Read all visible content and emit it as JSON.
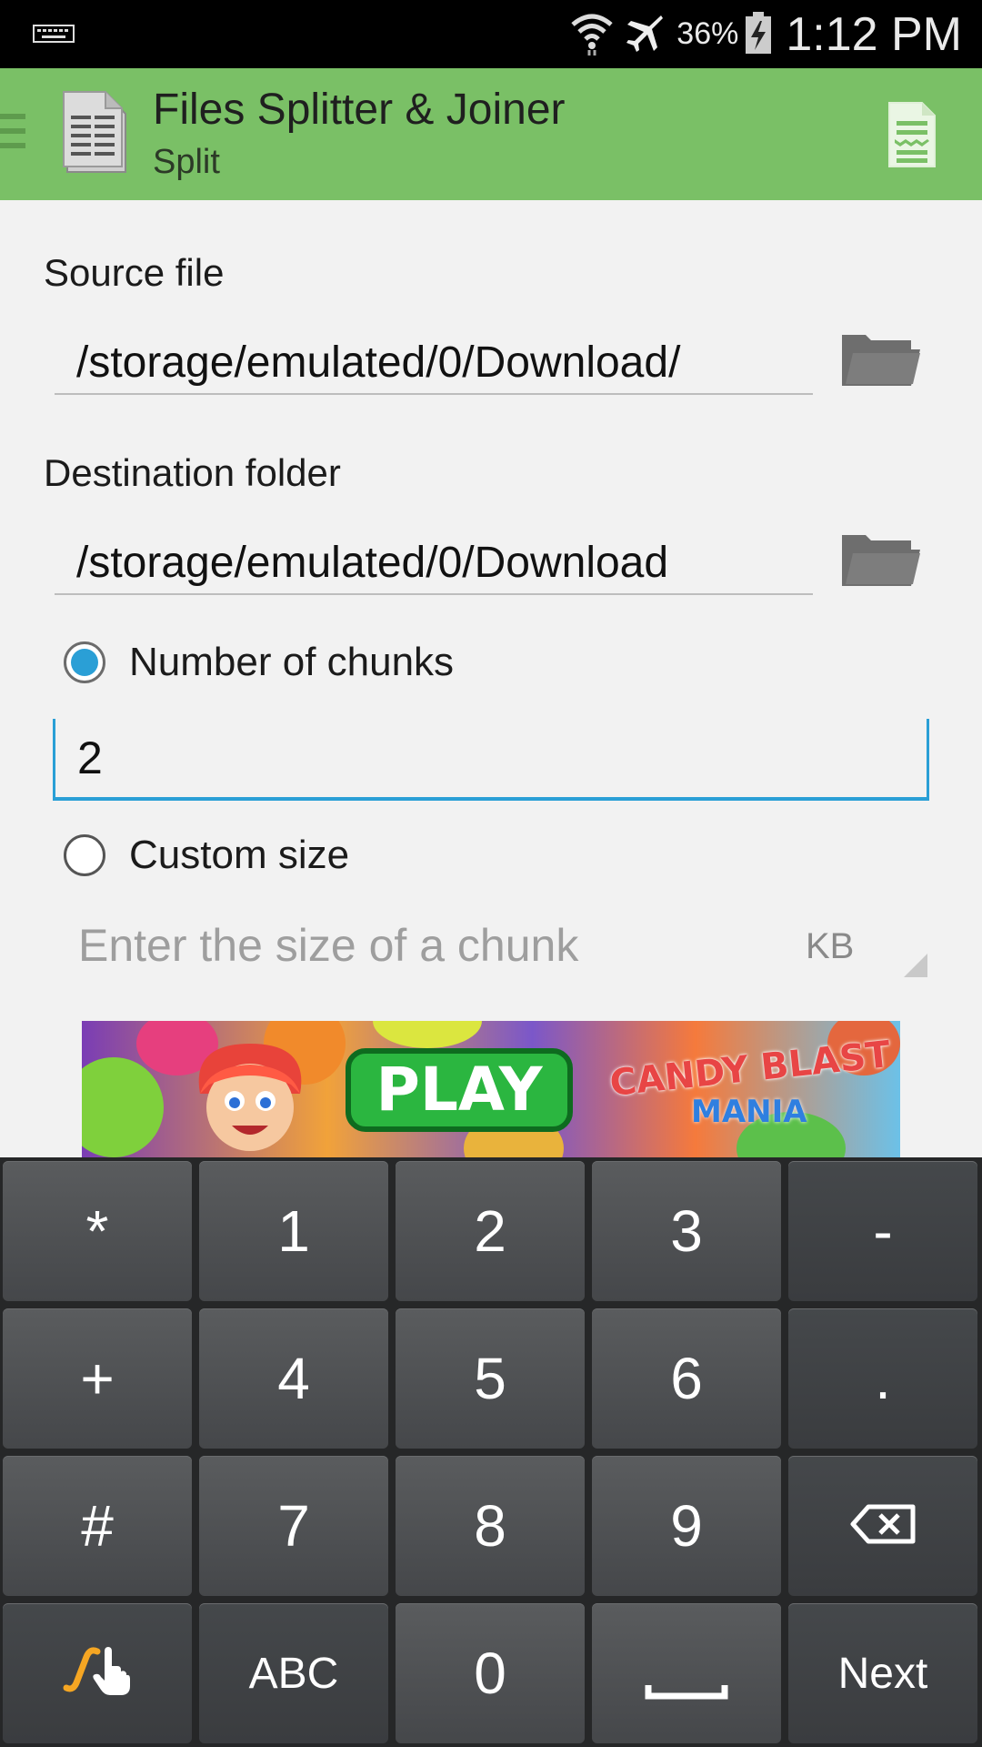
{
  "status_bar": {
    "battery": "36%",
    "time": "1:12 PM",
    "icons": [
      "keyboard-icon",
      "wifi-icon",
      "airplane-mode-icon",
      "battery-charging-icon"
    ]
  },
  "action_bar": {
    "title": "Files Splitter & Joiner",
    "subtitle": "Split",
    "bg_color": "#7ac066"
  },
  "form": {
    "source_label": "Source file",
    "source_value": "/storage/emulated/0/Download/",
    "destination_label": "Destination folder",
    "destination_value": "/storage/emulated/0/Download",
    "option_chunks_label": "Number of chunks",
    "option_chunks_selected": true,
    "chunks_value": "2",
    "option_custom_label": "Custom size",
    "option_custom_selected": false,
    "size_placeholder": "Enter the size of a chunk",
    "size_unit": "KB"
  },
  "ad": {
    "button_label": "PLAY",
    "brand_line1": "CANDY BLAST",
    "brand_line2": "MANIA"
  },
  "keyboard": {
    "rows": [
      [
        "*",
        "1",
        "2",
        "3",
        "-"
      ],
      [
        "+",
        "4",
        "5",
        "6",
        "."
      ],
      [
        "#",
        "7",
        "8",
        "9",
        "backspace"
      ],
      [
        "swype",
        "ABC",
        "0",
        "space",
        "Next"
      ]
    ]
  },
  "accent_color": "#2a9fd6"
}
